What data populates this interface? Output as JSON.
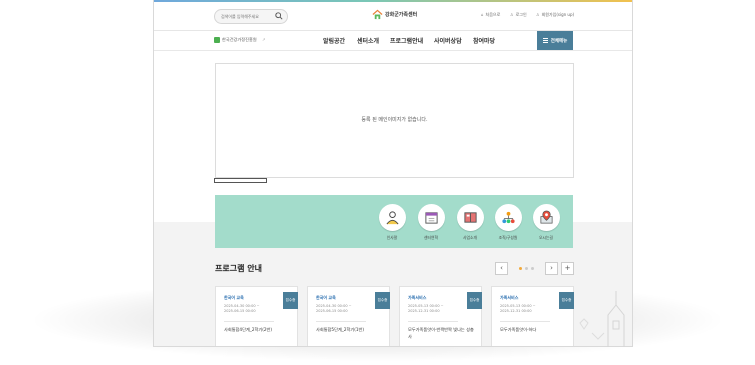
{
  "header": {
    "search_placeholder": "검색어를 입력해주세요",
    "site_title": "강화군가족센터",
    "util_links": [
      {
        "icon": "home-icon",
        "label": "처음으로"
      },
      {
        "icon": "user-icon",
        "label": "로그인"
      },
      {
        "icon": "user-plus-icon",
        "label": "회원가입(sign up)"
      }
    ],
    "family_site": "한국건강가정진흥원",
    "nav": [
      "알림공간",
      "센터소개",
      "프로그램안내",
      "사이버상담",
      "참여마당"
    ],
    "menu_label": "전체메뉴"
  },
  "banner": {
    "empty_text": "등록 된 메인이미지가 없습니다."
  },
  "quick_menu": [
    {
      "icon": "counselor-icon",
      "label": "인사말"
    },
    {
      "icon": "calendar-icon",
      "label": "센터연혁"
    },
    {
      "icon": "book-icon",
      "label": "사업소개"
    },
    {
      "icon": "org-chart-icon",
      "label": "조직/구성원"
    },
    {
      "icon": "map-pin-icon",
      "label": "오시는길"
    }
  ],
  "programs": {
    "title": "프로그램 안내",
    "prev": "‹",
    "next": "›",
    "more": "+",
    "cards": [
      {
        "tag": "한국어 교육",
        "date": "2025-04-30 00:00 ~\n2025-06-15 00:00",
        "title": "사회통합4단계_2학기(2반)",
        "button": "접수중"
      },
      {
        "tag": "한국어 교육",
        "date": "2025-04-30 00:00 ~\n2025-06-15 00:00",
        "title": "사회통합5단계_2학기(1반)",
        "button": "접수중"
      },
      {
        "tag": "가족서비스",
        "date": "2025-05-13 00:00 ~\n2025-12-31 00:00",
        "title": "모두가족품앗이-반짝반짝 빛나는 성충사",
        "button": "접수중"
      },
      {
        "tag": "가족서비스",
        "date": "2025-05-13 00:00 ~\n2025-12-31 00:00",
        "title": "모두가족품앗이-하다",
        "button": "접수중"
      }
    ]
  },
  "colors": {
    "accent": "#4a7e99",
    "quick_bg": "#a3dccb",
    "tag": "#2a6fb0"
  }
}
